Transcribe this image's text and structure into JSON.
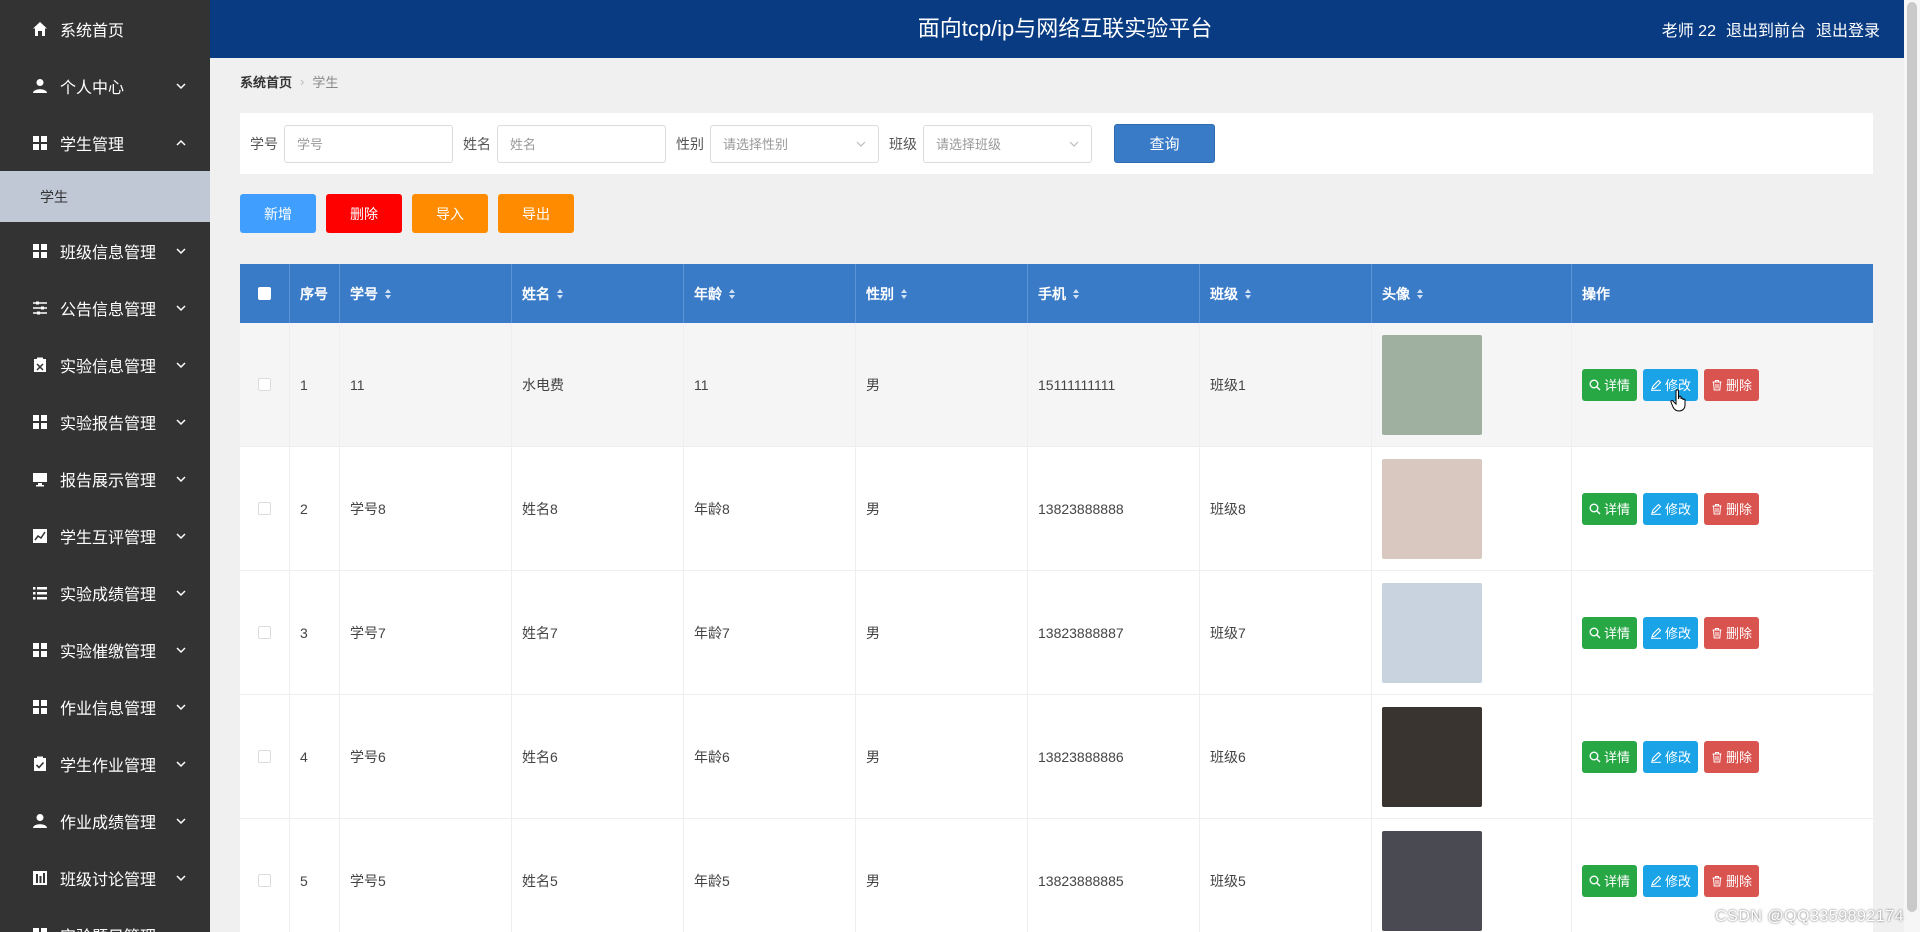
{
  "sidebar": {
    "items": [
      {
        "label": "系统首页",
        "icon": "home-icon",
        "chevron": "none"
      },
      {
        "label": "个人中心",
        "icon": "user-icon",
        "chevron": "down"
      },
      {
        "label": "学生管理",
        "icon": "grid-icon",
        "chevron": "up"
      },
      {
        "label": "班级信息管理",
        "icon": "grid-icon",
        "chevron": "down"
      },
      {
        "label": "公告信息管理",
        "icon": "sliders-icon",
        "chevron": "down"
      },
      {
        "label": "实验信息管理",
        "icon": "clipboard-icon",
        "chevron": "down"
      },
      {
        "label": "实验报告管理",
        "icon": "grid-icon",
        "chevron": "down"
      },
      {
        "label": "报告展示管理",
        "icon": "monitor-icon",
        "chevron": "down"
      },
      {
        "label": "学生互评管理",
        "icon": "chart-icon",
        "chevron": "down"
      },
      {
        "label": "实验成绩管理",
        "icon": "list-icon",
        "chevron": "down"
      },
      {
        "label": "实验催缴管理",
        "icon": "grid-icon",
        "chevron": "down"
      },
      {
        "label": "作业信息管理",
        "icon": "grid-icon",
        "chevron": "down"
      },
      {
        "label": "学生作业管理",
        "icon": "clipboard-check-icon",
        "chevron": "down"
      },
      {
        "label": "作业成绩管理",
        "icon": "user-icon",
        "chevron": "down"
      },
      {
        "label": "班级讨论管理",
        "icon": "bars-icon",
        "chevron": "down"
      },
      {
        "label": "实验题目管理",
        "icon": "grid-icon",
        "chevron": "down"
      }
    ],
    "submenu_label": "学生"
  },
  "header": {
    "title": "面向tcp/ip与网络互联实验平台",
    "user": "老师 22",
    "to_frontend": "退出到前台",
    "logout": "退出登录"
  },
  "breadcrumb": {
    "home": "系统首页",
    "current": "学生"
  },
  "search": {
    "student_no_label": "学号",
    "student_no_placeholder": "学号",
    "name_label": "姓名",
    "name_placeholder": "姓名",
    "gender_label": "性别",
    "gender_placeholder": "请选择性别",
    "class_label": "班级",
    "class_placeholder": "请选择班级",
    "query_label": "查询"
  },
  "actions": {
    "add": "新增",
    "delete": "删除",
    "import": "导入",
    "export": "导出"
  },
  "table": {
    "headers": {
      "no": "序号",
      "student_no": "学号",
      "name": "姓名",
      "age": "年龄",
      "gender": "性别",
      "phone": "手机",
      "class": "班级",
      "avatar": "头像",
      "ops": "操作"
    },
    "op_labels": {
      "detail": "详情",
      "edit": "修改",
      "remove": "删除"
    },
    "rows": [
      {
        "no": "1",
        "student_no": "11",
        "name": "水电费",
        "age": "11",
        "gender": "男",
        "phone": "15111111111",
        "class": "班级1",
        "avatar_color": "#9fb0a0"
      },
      {
        "no": "2",
        "student_no": "学号8",
        "name": "姓名8",
        "age": "年龄8",
        "gender": "男",
        "phone": "13823888888",
        "class": "班级8",
        "avatar_color": "#d8c8c0"
      },
      {
        "no": "3",
        "student_no": "学号7",
        "name": "姓名7",
        "age": "年龄7",
        "gender": "男",
        "phone": "13823888887",
        "class": "班级7",
        "avatar_color": "#c9d3e0"
      },
      {
        "no": "4",
        "student_no": "学号6",
        "name": "姓名6",
        "age": "年龄6",
        "gender": "男",
        "phone": "13823888886",
        "class": "班级6",
        "avatar_color": "#3a3430"
      },
      {
        "no": "5",
        "student_no": "学号5",
        "name": "姓名5",
        "age": "年龄5",
        "gender": "男",
        "phone": "13823888885",
        "class": "班级5",
        "avatar_color": "#4a4a52"
      }
    ]
  },
  "watermark": "CSDN @QQ3359892174",
  "colors": {
    "sidebar_bg": "#333333",
    "header_bg": "#083b82",
    "table_head": "#3a7bc8",
    "submenu_active": "#c0c8d6"
  }
}
